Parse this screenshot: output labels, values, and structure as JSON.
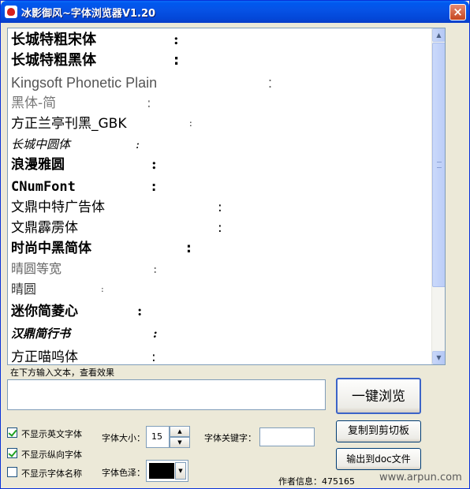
{
  "window": {
    "title": "冰影御风~字体浏览器V1.20",
    "close_glyph": "×"
  },
  "fonts": [
    {
      "name": "长城特粗宋体",
      "colon": ":",
      "style": "serif-bold"
    },
    {
      "name": "长城特粗黑体",
      "colon": ":",
      "style": "sans-bold"
    },
    {
      "name": "Kingsoft Phonetic Plain",
      "colon": ":",
      "style": "sans-light"
    },
    {
      "name": "黑体-简",
      "colon": ":",
      "style": "sans-light"
    },
    {
      "name": "方正兰亭刊黑_GBK",
      "colon": ":",
      "style": "sans"
    },
    {
      "name": "长城中圆体",
      "colon": ":",
      "style": "script"
    },
    {
      "name": "浪漫雅圆",
      "colon": ":",
      "style": "decor-bold"
    },
    {
      "name": "CNumFont",
      "colon": ":",
      "style": "mono-bold"
    },
    {
      "name": "文鼎中特广告体",
      "colon": ":",
      "style": "sans"
    },
    {
      "name": "文鼎霹雳体",
      "colon": ":",
      "style": "sans"
    },
    {
      "name": "时尚中黑简体",
      "colon": ":",
      "style": "sans-bold"
    },
    {
      "name": "晴圆等宽",
      "colon": ":",
      "style": "thin"
    },
    {
      "name": "晴圆",
      "colon": ":",
      "style": "thin"
    },
    {
      "name": "迷你简菱心",
      "colon": ":",
      "style": "sans-bold"
    },
    {
      "name": "汉鼎简行书",
      "colon": ":",
      "style": "script-bold"
    },
    {
      "name": "方正喵呜体",
      "colon": ":",
      "style": "sans"
    }
  ],
  "input": {
    "hint": "在下方输入文本，查看效果",
    "value": ""
  },
  "buttons": {
    "browse": "一键浏览",
    "copy": "复制到剪切板",
    "export": "输出到doc文件"
  },
  "options": [
    {
      "label": "不显示英文字体",
      "checked": true
    },
    {
      "label": "不显示纵向字体",
      "checked": true
    },
    {
      "label": "不显示字体名称",
      "checked": false
    }
  ],
  "font_size": {
    "label": "字体大小：",
    "value": "15",
    "up_glyph": "▲",
    "down_glyph": "▼"
  },
  "keyword": {
    "label": "字体关键字：",
    "value": ""
  },
  "color": {
    "label": "字体色泽：",
    "value": "#000000",
    "drop_glyph": "▼"
  },
  "author": {
    "text": "作者信息：475165"
  },
  "watermark": {
    "text": "www.arpun.com"
  },
  "scrollbar": {
    "up_glyph": "▲",
    "down_glyph": "▼"
  }
}
